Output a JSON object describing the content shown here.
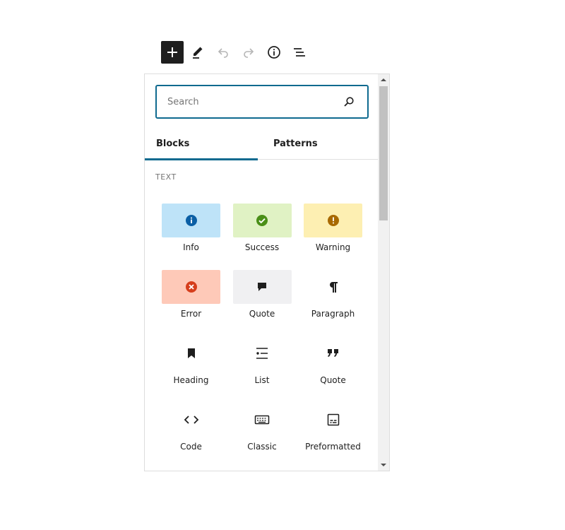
{
  "toolbar": {
    "icons": [
      "plus-icon",
      "pencil-icon",
      "undo-icon",
      "redo-icon",
      "info-icon",
      "list-view-icon"
    ]
  },
  "search": {
    "placeholder": "Search"
  },
  "tabs": [
    {
      "label": "Blocks",
      "active": true
    },
    {
      "label": "Patterns",
      "active": false
    }
  ],
  "section": {
    "title": "TEXT"
  },
  "blocks": [
    {
      "label": "Info",
      "icon": "info-icon",
      "bg": "#bee3f8",
      "color": "#0b5fa5"
    },
    {
      "label": "Success",
      "icon": "check-circle-icon",
      "bg": "#e0f2c4",
      "color": "#4a8f17"
    },
    {
      "label": "Warning",
      "icon": "alert-icon",
      "bg": "#fdefb2",
      "color": "#a86900"
    },
    {
      "label": "Error",
      "icon": "error-circle-icon",
      "bg": "#fec9b8",
      "color": "#d63e1c"
    },
    {
      "label": "Quote",
      "icon": "speech-bubble-icon",
      "bg": "#f0f0f2",
      "color": "#1e1e1e"
    },
    {
      "label": "Paragraph",
      "icon": "pilcrow-icon",
      "bg": "",
      "color": "#1e1e1e"
    },
    {
      "label": "Heading",
      "icon": "bookmark-icon",
      "bg": "",
      "color": "#1e1e1e"
    },
    {
      "label": "List",
      "icon": "list-icon",
      "bg": "",
      "color": "#1e1e1e"
    },
    {
      "label": "Quote",
      "icon": "quote-marks-icon",
      "bg": "",
      "color": "#1e1e1e"
    },
    {
      "label": "Code",
      "icon": "code-icon",
      "bg": "",
      "color": "#1e1e1e"
    },
    {
      "label": "Classic",
      "icon": "keyboard-icon",
      "bg": "",
      "color": "#1e1e1e"
    },
    {
      "label": "Preformatted",
      "icon": "preformatted-icon",
      "bg": "",
      "color": "#1e1e1e"
    }
  ],
  "colors": {
    "accent": "#0f6a8f",
    "dark": "#1e1e1e",
    "muted": "#757575"
  }
}
